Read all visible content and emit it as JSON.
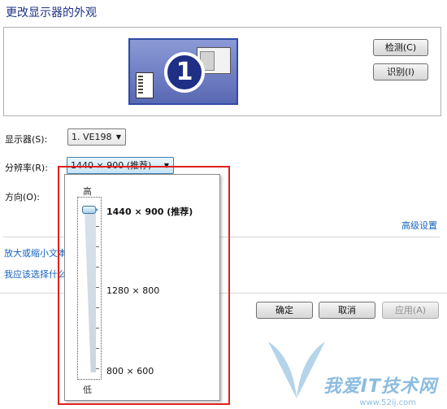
{
  "window": {
    "title": "更改显示器的外观"
  },
  "preview": {
    "monitor_number": "1",
    "detect_label": "检测(C)",
    "identify_label": "识别(I)"
  },
  "display": {
    "label": "显示器(S):",
    "value": "1. VE198"
  },
  "resolution": {
    "label": "分辨率(R):",
    "value": "1440 × 900 (推荐)",
    "slider_high_label": "高",
    "slider_low_label": "低",
    "options": [
      "1440 × 900 (推荐)",
      "1280 × 800",
      "800 × 600"
    ],
    "selected_fraction": 1.0
  },
  "orientation": {
    "label": "方向(O):"
  },
  "links": {
    "advanced": "高级设置",
    "text_size": "放大或缩小文本",
    "which_settings": "我应该选择什么"
  },
  "footer": {
    "ok_label": "确定",
    "cancel_label": "取消",
    "apply_label": "应用(A)"
  },
  "watermark": {
    "brand": "我爱IT技术网",
    "url": "www.52ij.com"
  },
  "colors": {
    "title": "#1e3287",
    "link": "#1563c0",
    "highlight_border": "#e0201b",
    "monitor_fill": "#6e7fc4"
  }
}
